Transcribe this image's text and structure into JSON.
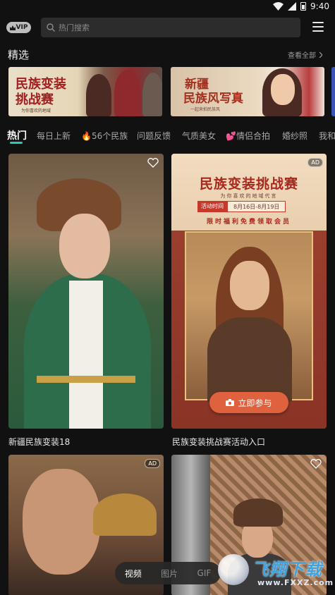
{
  "status_bar": {
    "time": "9:40"
  },
  "header": {
    "vip_label": "VIP",
    "search_placeholder": "热门搜索"
  },
  "featured": {
    "title": "精选",
    "see_all": "查看全部",
    "banners": [
      {
        "line1": "民族变装",
        "line2": "挑战赛",
        "sub": "为你喜欢的地域"
      },
      {
        "line1": "新疆",
        "line2": "民族风写真",
        "sub": "一起来拍民族风"
      }
    ]
  },
  "tabs": [
    {
      "label": "热门",
      "active": true
    },
    {
      "label": "每日上新"
    },
    {
      "label": "56个民族",
      "icon": "fire-icon"
    },
    {
      "label": "问题反馈"
    },
    {
      "label": "气质美女"
    },
    {
      "label": "情侣合拍",
      "icon": "hearts-icon"
    },
    {
      "label": "婚纱照"
    },
    {
      "label": "我和"
    }
  ],
  "cards": [
    {
      "title": "新疆民族变装18"
    },
    {
      "title": "民族变装挑战赛活动入口",
      "ad_badge": "AD",
      "poster": {
        "heading": "民族变装挑战赛",
        "subheading": "为你喜欢的地域代言",
        "time_label": "活动时间",
        "time_range": "8月16日-8月19日",
        "benefit": "限时福利免费领取会员",
        "button": "立即参与"
      }
    },
    {
      "ad_badge": "AD"
    },
    {}
  ],
  "media_switch": {
    "items": [
      "视频",
      "图片",
      "GIF"
    ],
    "selected": "视频"
  },
  "watermark": {
    "text": "飞翔下载",
    "url": "www.FXXZ.com"
  },
  "colors": {
    "background": "#111111",
    "accent": "#2cc9b4",
    "cta": "#e0613e"
  }
}
